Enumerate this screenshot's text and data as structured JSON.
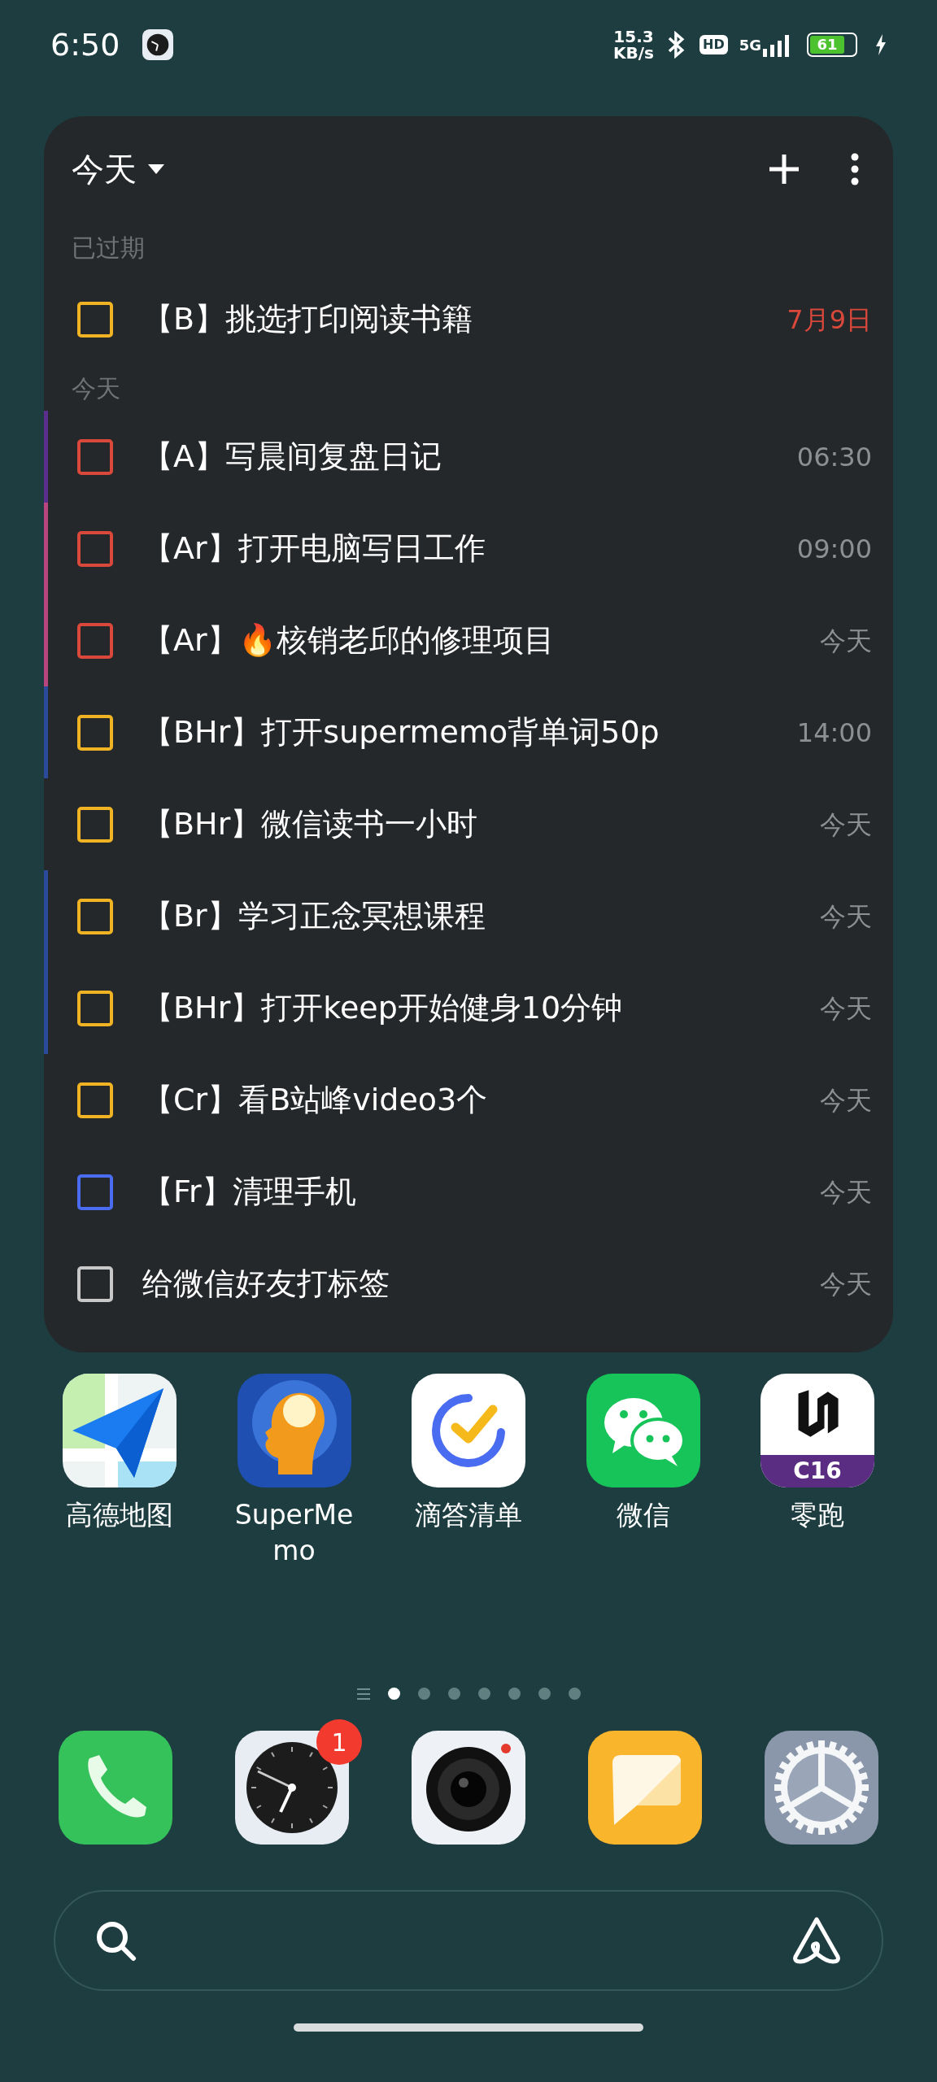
{
  "status_bar": {
    "time": "6:50",
    "speed_value": "15.3",
    "speed_unit": "KB/s",
    "hd": "HD",
    "network": "5G",
    "battery": "61"
  },
  "widget": {
    "title": "今天",
    "sections": [
      {
        "title": "已过期",
        "tasks": [
          {
            "text": "【B】挑选打印阅读书籍",
            "due": "7月9日",
            "overdue": true,
            "color": "#f0b323"
          }
        ]
      },
      {
        "title": "今天",
        "tasks": [
          {
            "text": "【A】写晨间复盘日记",
            "due": "06:30",
            "overdue": false,
            "color": "#d9483b",
            "list": {
              "color": "#5b2d8c"
            }
          },
          {
            "text": "【Ar】打开电脑写日工作",
            "due": "09:00",
            "overdue": false,
            "color": "#d9483b",
            "list": {
              "color": "#b8457e"
            }
          },
          {
            "text": "【Ar】🔥核销老邱的修理项目",
            "due": "今天",
            "overdue": false,
            "color": "#d9483b",
            "list": {
              "color": "#b8457e"
            }
          },
          {
            "text": "【BHr】打开supermemo背单词50p",
            "due": "14:00",
            "overdue": false,
            "color": "#f0b323",
            "list": {
              "color": "#2c4a9a"
            }
          },
          {
            "text": "【BHr】微信读书一小时",
            "due": "今天",
            "overdue": false,
            "color": "#f0b323"
          },
          {
            "text": "【Br】学习正念冥想课程",
            "due": "今天",
            "overdue": false,
            "color": "#f0b323",
            "list": {
              "color": "#2c4a9a"
            }
          },
          {
            "text": "【BHr】打开keep开始健身10分钟",
            "due": "今天",
            "overdue": false,
            "color": "#f0b323",
            "list": {
              "color": "#2c4a9a"
            }
          },
          {
            "text": "【Cr】看B站峰video3个",
            "due": "今天",
            "overdue": false,
            "color": "#f0b323"
          },
          {
            "text": "【Fr】清理手机",
            "due": "今天",
            "overdue": false,
            "color": "#4a6cf0"
          },
          {
            "text": "给微信好友打标签",
            "due": "今天",
            "overdue": false,
            "color": "#c8c8c8"
          }
        ]
      }
    ]
  },
  "apps": [
    {
      "label": "高德地图"
    },
    {
      "label": "SuperMemo"
    },
    {
      "label": "滴答清单"
    },
    {
      "label": "微信"
    },
    {
      "label": "零跑",
      "icon_text": "C16"
    }
  ],
  "pages": [
    {
      "selected": true
    },
    {
      "selected": false
    },
    {
      "selected": false
    },
    {
      "selected": false
    },
    {
      "selected": false
    },
    {
      "selected": false
    },
    {
      "selected": false
    }
  ],
  "dock": [
    {
      "kind": "phone"
    },
    {
      "kind": "clock",
      "badge": "1"
    },
    {
      "kind": "camera"
    },
    {
      "kind": "notes"
    },
    {
      "kind": "settings"
    }
  ]
}
